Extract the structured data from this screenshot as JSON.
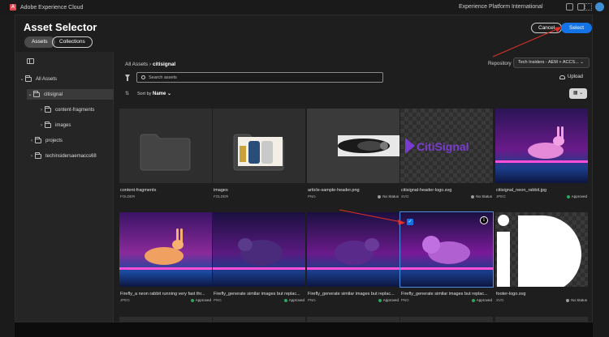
{
  "topbar": {
    "product": "Adobe Experience Cloud",
    "org": "Experience Platform International"
  },
  "modal": {
    "title": "Asset Selector",
    "tabs": [
      {
        "label": "Assets"
      },
      {
        "label": "Collections"
      }
    ],
    "cancel_label": "Cancel",
    "select_label": "Select"
  },
  "sidebar": {
    "items": [
      {
        "label": "All Assets",
        "level": 0,
        "chevron": "⌄"
      },
      {
        "label": "citisignal",
        "level": 1,
        "chevron": "⌄",
        "selected": true
      },
      {
        "label": "content-fragments",
        "level": 2,
        "chevron": "›"
      },
      {
        "label": "images",
        "level": 2,
        "chevron": "›"
      },
      {
        "label": "projects",
        "level": 1,
        "chevron": "›"
      },
      {
        "label": "techinsidersaemaccs68",
        "level": 1,
        "chevron": "›"
      }
    ]
  },
  "main": {
    "breadcrumb_root": "All Assets",
    "breadcrumb_sep": "›",
    "breadcrumb_current": "citisignal",
    "repository_label": "Repository",
    "repository_value": "Tech Insiders - AEM + ACCS... ⌄",
    "search_placeholder": "Search assets",
    "upload_label": "Upload",
    "sort_label": "Sort by",
    "sort_value": "Name ⌄",
    "view_toggle": "▦ ⌄"
  },
  "cards": [
    {
      "name": "content-fragments",
      "type": "FOLDER",
      "status": "",
      "status_color": ""
    },
    {
      "name": "images",
      "type": "FOLDER",
      "status": "",
      "status_color": ""
    },
    {
      "name": "article-sample-header.png",
      "type": "PNG",
      "status": "No Status",
      "status_color": "#9a9a9a"
    },
    {
      "name": "citisignal-header-logo.svg",
      "type": "SVG",
      "status": "No Status",
      "status_color": "#9a9a9a"
    },
    {
      "name": "citisignal_neon_rabbit.jpg",
      "type": "JPEG",
      "status": "Approved",
      "status_color": "#2ea55e"
    },
    {
      "name": "Firefly_a neon rabbit running very fast thr...",
      "type": "JPEG",
      "status": "Approved",
      "status_color": "#2ea55e"
    },
    {
      "name": "Firefly_generate similar images but replac...",
      "type": "PNG",
      "status": "Approved",
      "status_color": "#2ea55e"
    },
    {
      "name": "Firefly_generate similar images but replac...",
      "type": "PNG",
      "status": "Approved",
      "status_color": "#2ea55e"
    },
    {
      "name": "Firefly_generate similar images but replac...",
      "type": "PNG",
      "status": "Approved",
      "status_color": "#2ea55e"
    },
    {
      "name": "footer-logo.svg",
      "type": "SVG",
      "status": "No Status",
      "status_color": "#9a9a9a"
    }
  ],
  "logo_text": "CitiSignal",
  "checkbox_mark": "✓",
  "info_mark": "i",
  "colors": {
    "accent": "#1473e6",
    "approved": "#2ea55e",
    "annotation": "#e0312a"
  }
}
